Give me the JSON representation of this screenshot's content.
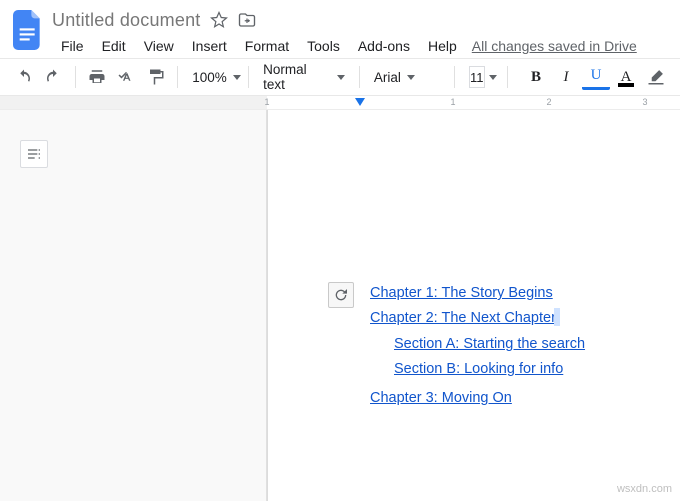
{
  "header": {
    "doc_title": "Untitled document",
    "save_status": "All changes saved in Drive"
  },
  "menu": {
    "items": [
      "File",
      "Edit",
      "View",
      "Insert",
      "Format",
      "Tools",
      "Add-ons",
      "Help"
    ]
  },
  "toolbar": {
    "zoom": "100%",
    "style": "Normal text",
    "font": "Arial",
    "font_size": "11",
    "bold": "B",
    "italic": "I",
    "underline": "U",
    "textcolor": "A"
  },
  "ruler": {
    "numbers": [
      "1",
      "1",
      "2",
      "3"
    ]
  },
  "toc": {
    "items": [
      {
        "text": "Chapter 1: The Story Begins",
        "level": 0,
        "cursor": false
      },
      {
        "text": "Chapter 2: The Next Chapter",
        "level": 0,
        "cursor": true
      },
      {
        "text": "Section A: Starting the search",
        "level": 1,
        "cursor": false
      },
      {
        "text": "Section B: Looking for info",
        "level": 1,
        "cursor": false
      },
      {
        "text": "Chapter 3: Moving On",
        "level": 0,
        "cursor": false
      }
    ]
  },
  "watermark": "wsxdn.com"
}
